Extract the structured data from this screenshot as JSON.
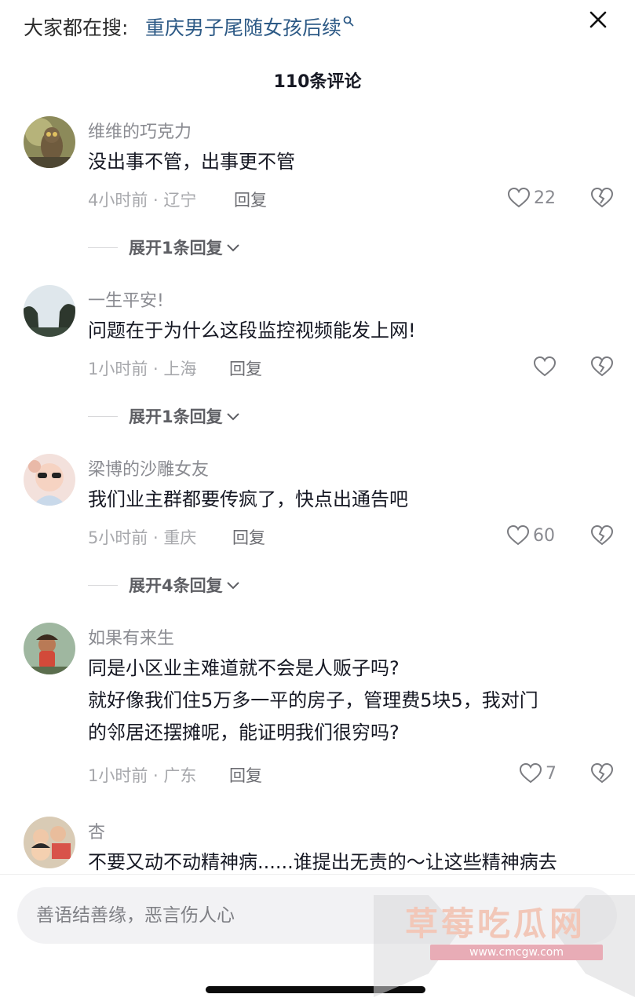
{
  "search": {
    "prefix": "大家都在搜:",
    "term": "重庆男子尾随女孩后续"
  },
  "header": {
    "count_label": "110条评论"
  },
  "comments": [
    {
      "nickname": "维维的巧克力",
      "text": "没出事不管，出事更不管",
      "time_location": "4小时前 · 辽宁",
      "reply_label": "回复",
      "likes": "22",
      "expand_label": "展开1条回复"
    },
    {
      "nickname": "一生平安!",
      "text": "问题在于为什么这段监控视频能发上网!",
      "time_location": "1小时前 · 上海",
      "reply_label": "回复",
      "likes": "",
      "expand_label": "展开1条回复"
    },
    {
      "nickname": "梁博的沙雕女友",
      "text": "我们业主群都要传疯了，快点出通告吧",
      "time_location": "5小时前 · 重庆",
      "reply_label": "回复",
      "likes": "60",
      "expand_label": "展开4条回复"
    },
    {
      "nickname": "如果有来生",
      "text_lines": [
        "同是小区业主难道就不会是人贩子吗?",
        "就好像我们住5万多一平的房子，管理费5块5，我对门",
        "的邻居还摆摊呢，能证明我们很穷吗?"
      ],
      "time_location": "1小时前 · 广东",
      "reply_label": "回复",
      "likes": "7"
    },
    {
      "nickname": "杏",
      "text": "不要又动不动精神病......谁提出无责的～让这些精神病去"
    }
  ],
  "input": {
    "placeholder": "善语结善缘，恶言伤人心"
  },
  "watermark": {
    "title": "草莓吃瓜网",
    "url": "www.cmcgw.com"
  },
  "colors": {
    "link": "#2d5a86",
    "muted": "#8a8b91",
    "text": "#161823"
  },
  "icons": [
    "search-icon",
    "close-icon",
    "heart-icon",
    "broken-heart-icon",
    "chevron-down-icon"
  ]
}
